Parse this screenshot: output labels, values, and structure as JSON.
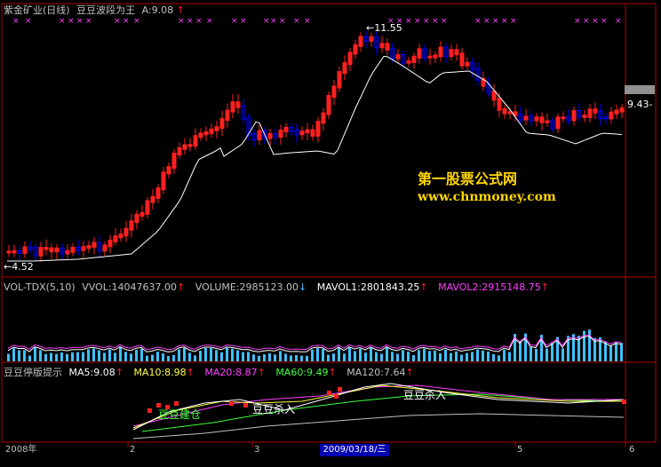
{
  "main": {
    "stock_name": "紫金矿业(日线)",
    "indicator": "豆豆波段为王",
    "a_value": "A:9.08",
    "label_high": "11.55",
    "label_low": "4.52",
    "label_right": "9.43-"
  },
  "volume": {
    "name": "VOL-TDX(5,10)",
    "vvol": "VVOL:14047637.00",
    "volume": "VOLUME:2985123.00",
    "mavol1": "MAVOL1:2801843.25",
    "mavol2": "MAVOL2:2915148.75"
  },
  "ma_panel": {
    "name": "豆豆停版提示",
    "ma5": "MA5:9.08",
    "ma10": "MA10:8.98",
    "ma20": "MA20:8.87",
    "ma60": "MA60:9.49",
    "ma120": "MA120:7.64",
    "ann1": "豆豆建仓",
    "ann2": "豆豆杀入",
    "ann3": "豆豆杀入"
  },
  "watermark": {
    "line1": "第一股票公式网",
    "line2": "www.chnmoney.com"
  },
  "axis": {
    "ticks": [
      "2008年",
      "2",
      "3",
      "5",
      "6"
    ],
    "selected_date": "2009/03/18/三"
  },
  "colors": {
    "up": "#ff2020",
    "down": "#0000ff",
    "ma_white": "#ffffff",
    "magenta": "#ff40ff",
    "yellow": "#ffff40",
    "green": "#40ff40",
    "cyan": "#40c0ff",
    "border": "#b00000"
  }
}
